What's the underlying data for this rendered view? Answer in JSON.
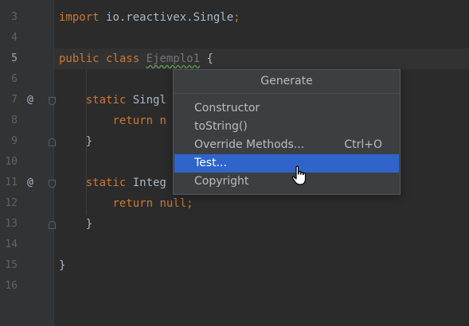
{
  "editor": {
    "lines": [
      {
        "number": "3",
        "parts": [
          {
            "t": "import ",
            "c": "kw"
          },
          {
            "t": "io.reactivex.Single",
            "c": "cls"
          },
          {
            "t": ";",
            "c": "kw"
          }
        ]
      },
      {
        "number": "4",
        "parts": []
      },
      {
        "number": "5",
        "active": true,
        "parts": [
          {
            "t": "public ",
            "c": "kw"
          },
          {
            "t": "class ",
            "c": "kw"
          },
          {
            "t": "Ejemplo1",
            "c": "unused"
          },
          {
            "t": " {",
            "c": "cls"
          }
        ]
      },
      {
        "number": "6",
        "parts": []
      },
      {
        "number": "7",
        "mark": "@",
        "parts": [
          {
            "t": "    static ",
            "c": "kw"
          },
          {
            "t": "Singl",
            "c": "cls"
          }
        ]
      },
      {
        "number": "8",
        "parts": [
          {
            "t": "        return ",
            "c": "kw"
          },
          {
            "t": "n",
            "c": "kw"
          }
        ]
      },
      {
        "number": "9",
        "parts": [
          {
            "t": "    }",
            "c": "cls"
          }
        ]
      },
      {
        "number": "10",
        "parts": []
      },
      {
        "number": "11",
        "mark": "@",
        "parts": [
          {
            "t": "    static ",
            "c": "kw"
          },
          {
            "t": "Integ",
            "c": "cls"
          }
        ]
      },
      {
        "number": "12",
        "parts": [
          {
            "t": "        return ",
            "c": "kw"
          },
          {
            "t": "null",
            "c": "kw"
          },
          {
            "t": ";",
            "c": "kw"
          }
        ]
      },
      {
        "number": "13",
        "parts": [
          {
            "t": "    }",
            "c": "cls"
          }
        ]
      },
      {
        "number": "14",
        "parts": []
      },
      {
        "number": "15",
        "parts": [
          {
            "t": "}",
            "c": "cls"
          }
        ]
      },
      {
        "number": "16",
        "parts": []
      }
    ]
  },
  "popup": {
    "title": "Generate",
    "items": [
      {
        "label": "Constructor",
        "shortcut": ""
      },
      {
        "label": "toString()",
        "shortcut": ""
      },
      {
        "label": "Override Methods...",
        "shortcut": "Ctrl+O"
      },
      {
        "label": "Test...",
        "shortcut": "",
        "selected": true
      },
      {
        "label": "Copyright",
        "shortcut": ""
      }
    ]
  },
  "colors": {
    "background": "#2b2b2b",
    "gutter": "#313335",
    "keyword": "#cc7832",
    "text": "#a9b7c6",
    "selection": "#2f65ca",
    "popup_bg": "#3c3f41"
  },
  "icons": {
    "cursor": "hand-pointer-icon",
    "override_marker": "at-sign-icon"
  }
}
